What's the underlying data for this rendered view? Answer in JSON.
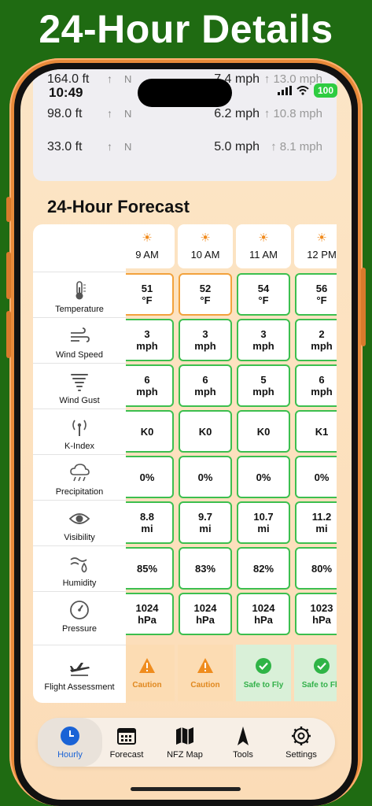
{
  "headline": "24-Hour Details",
  "status": {
    "time": "10:49",
    "battery": "100"
  },
  "wind_rows": [
    {
      "altitude": "164.0 ft",
      "arrow": "↑",
      "direction": "N",
      "speed": "7.4 mph",
      "gust": "↑ 13.0 mph"
    },
    {
      "altitude": "98.0 ft",
      "arrow": "↑",
      "direction": "N",
      "speed": "6.2 mph",
      "gust": "↑ 10.8 mph"
    },
    {
      "altitude": "33.0 ft",
      "arrow": "↑",
      "direction": "N",
      "speed": "5.0 mph",
      "gust": "↑ 8.1 mph"
    }
  ],
  "forecast_title": "24-Hour Forecast",
  "labels": {
    "temperature": "Temperature",
    "wind_speed": "Wind Speed",
    "wind_gust": "Wind Gust",
    "k_index": "K-Index",
    "precipitation": "Precipitation",
    "visibility": "Visibility",
    "humidity": "Humidity",
    "pressure": "Pressure",
    "flight_assessment": "Flight Assessment"
  },
  "hours": [
    {
      "time": "9 AM",
      "temp": "51\n°F",
      "wind": "3\nmph",
      "gust": "6\nmph",
      "k": "K0",
      "precip": "0%",
      "vis": "8.8\nmi",
      "humidity": "85%",
      "pressure": "1024\nhPa",
      "assessment": "Caution",
      "status": "caution"
    },
    {
      "time": "10 AM",
      "temp": "52\n°F",
      "wind": "3\nmph",
      "gust": "6\nmph",
      "k": "K0",
      "precip": "0%",
      "vis": "9.7\nmi",
      "humidity": "83%",
      "pressure": "1024\nhPa",
      "assessment": "Caution",
      "status": "caution"
    },
    {
      "time": "11 AM",
      "temp": "54\n°F",
      "wind": "3\nmph",
      "gust": "5\nmph",
      "k": "K0",
      "precip": "0%",
      "vis": "10.7\nmi",
      "humidity": "82%",
      "pressure": "1024\nhPa",
      "assessment": "Safe to Fly",
      "status": "safe"
    },
    {
      "time": "12 PM",
      "temp": "56\n°F",
      "wind": "2\nmph",
      "gust": "6\nmph",
      "k": "K1",
      "precip": "0%",
      "vis": "11.2\nmi",
      "humidity": "80%",
      "pressure": "1023\nhPa",
      "assessment": "Safe to Fly",
      "status": "safe"
    }
  ],
  "tabs": [
    {
      "label": "Hourly",
      "icon": "clock-icon",
      "active": true
    },
    {
      "label": "Forecast",
      "icon": "calendar-icon",
      "active": false
    },
    {
      "label": "NFZ Map",
      "icon": "map-icon",
      "active": false
    },
    {
      "label": "Tools",
      "icon": "compass-icon",
      "active": false
    },
    {
      "label": "Settings",
      "icon": "gear-icon",
      "active": false
    }
  ],
  "colors": {
    "background": "#1f6b12",
    "frame": "#e88a3a",
    "safe": "#3cbf4f",
    "caution": "#f2a23c",
    "active_tab": "#1a63d6"
  }
}
